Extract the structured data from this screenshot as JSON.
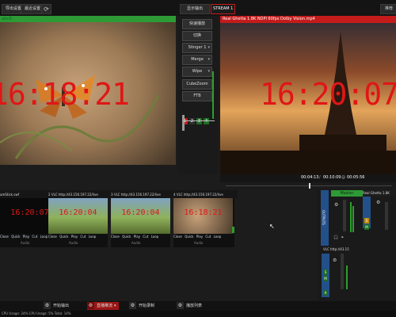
{
  "top_bar": {
    "buttons": [
      "导出设置",
      "最近设置"
    ],
    "output_button": "显示输出",
    "stream_badge": "STREAM 1",
    "right_button": "推荐"
  },
  "preview": {
    "title": "sinc5",
    "clock": "16:18:21",
    "bar_color": "#2e9a36"
  },
  "program": {
    "title": "Real Ghetta 1.8K NDPI 60fps Dolby Vision.mp4",
    "clock": "16:20:07",
    "time_position": "00:04:13",
    "time_duration": "00:10:09",
    "time_remaining": "00:05:56",
    "bar_color": "#c51b1b"
  },
  "transitions": {
    "quick_play": "快速播放",
    "cut": "切换",
    "effects": [
      {
        "label": "Stinger 1"
      },
      {
        "label": "Merge"
      },
      {
        "label": "Wipe"
      }
    ],
    "cube_zoom": "CubeZoom",
    "ftb": "FTB",
    "numbers": [
      "1",
      "2",
      "3",
      "4"
    ]
  },
  "clips": [
    {
      "index": "",
      "label": "amStick.swf",
      "clock": "16:20:07",
      "controls": [
        "Close",
        "Quick",
        "Play",
        "Cut",
        "Loop"
      ],
      "sub": "Audio"
    },
    {
      "index": "2",
      "label": "VLC http://43.156.197.22/live",
      "clock": "16:20:04",
      "controls": [
        "Close",
        "Quick",
        "Play",
        "Cut",
        "Loop"
      ],
      "sub": "Audio"
    },
    {
      "index": "3",
      "label": "VLC http://43.156.197.22/live",
      "clock": "16:20:04",
      "controls": [
        "Close",
        "Quick",
        "Play",
        "Cut",
        "Loop"
      ],
      "sub": "Audio"
    },
    {
      "index": "4",
      "label": "VLC http://43.156.197.22/live",
      "clock": "16:18:21",
      "controls": [
        "Close",
        "Quick",
        "Play",
        "Cut",
        "Loop"
      ],
      "sub": "Audio"
    }
  ],
  "mixer": {
    "master_label": "Master",
    "outputs_label": "OUTPUTS",
    "channel_label": "Real Ghetta 1.8K",
    "vlc_label": "VLC http://43.15",
    "channel_letters": [
      "S",
      "M",
      "A",
      "B"
    ]
  },
  "bottom_bar": {
    "buttons": [
      "开始输出",
      "直播推流",
      "开始录制",
      "播放列表"
    ],
    "record_accent": "#9b1515"
  },
  "status": {
    "text": "CPU Usage: 24% CPU Usage: 5% Total: 14%"
  }
}
